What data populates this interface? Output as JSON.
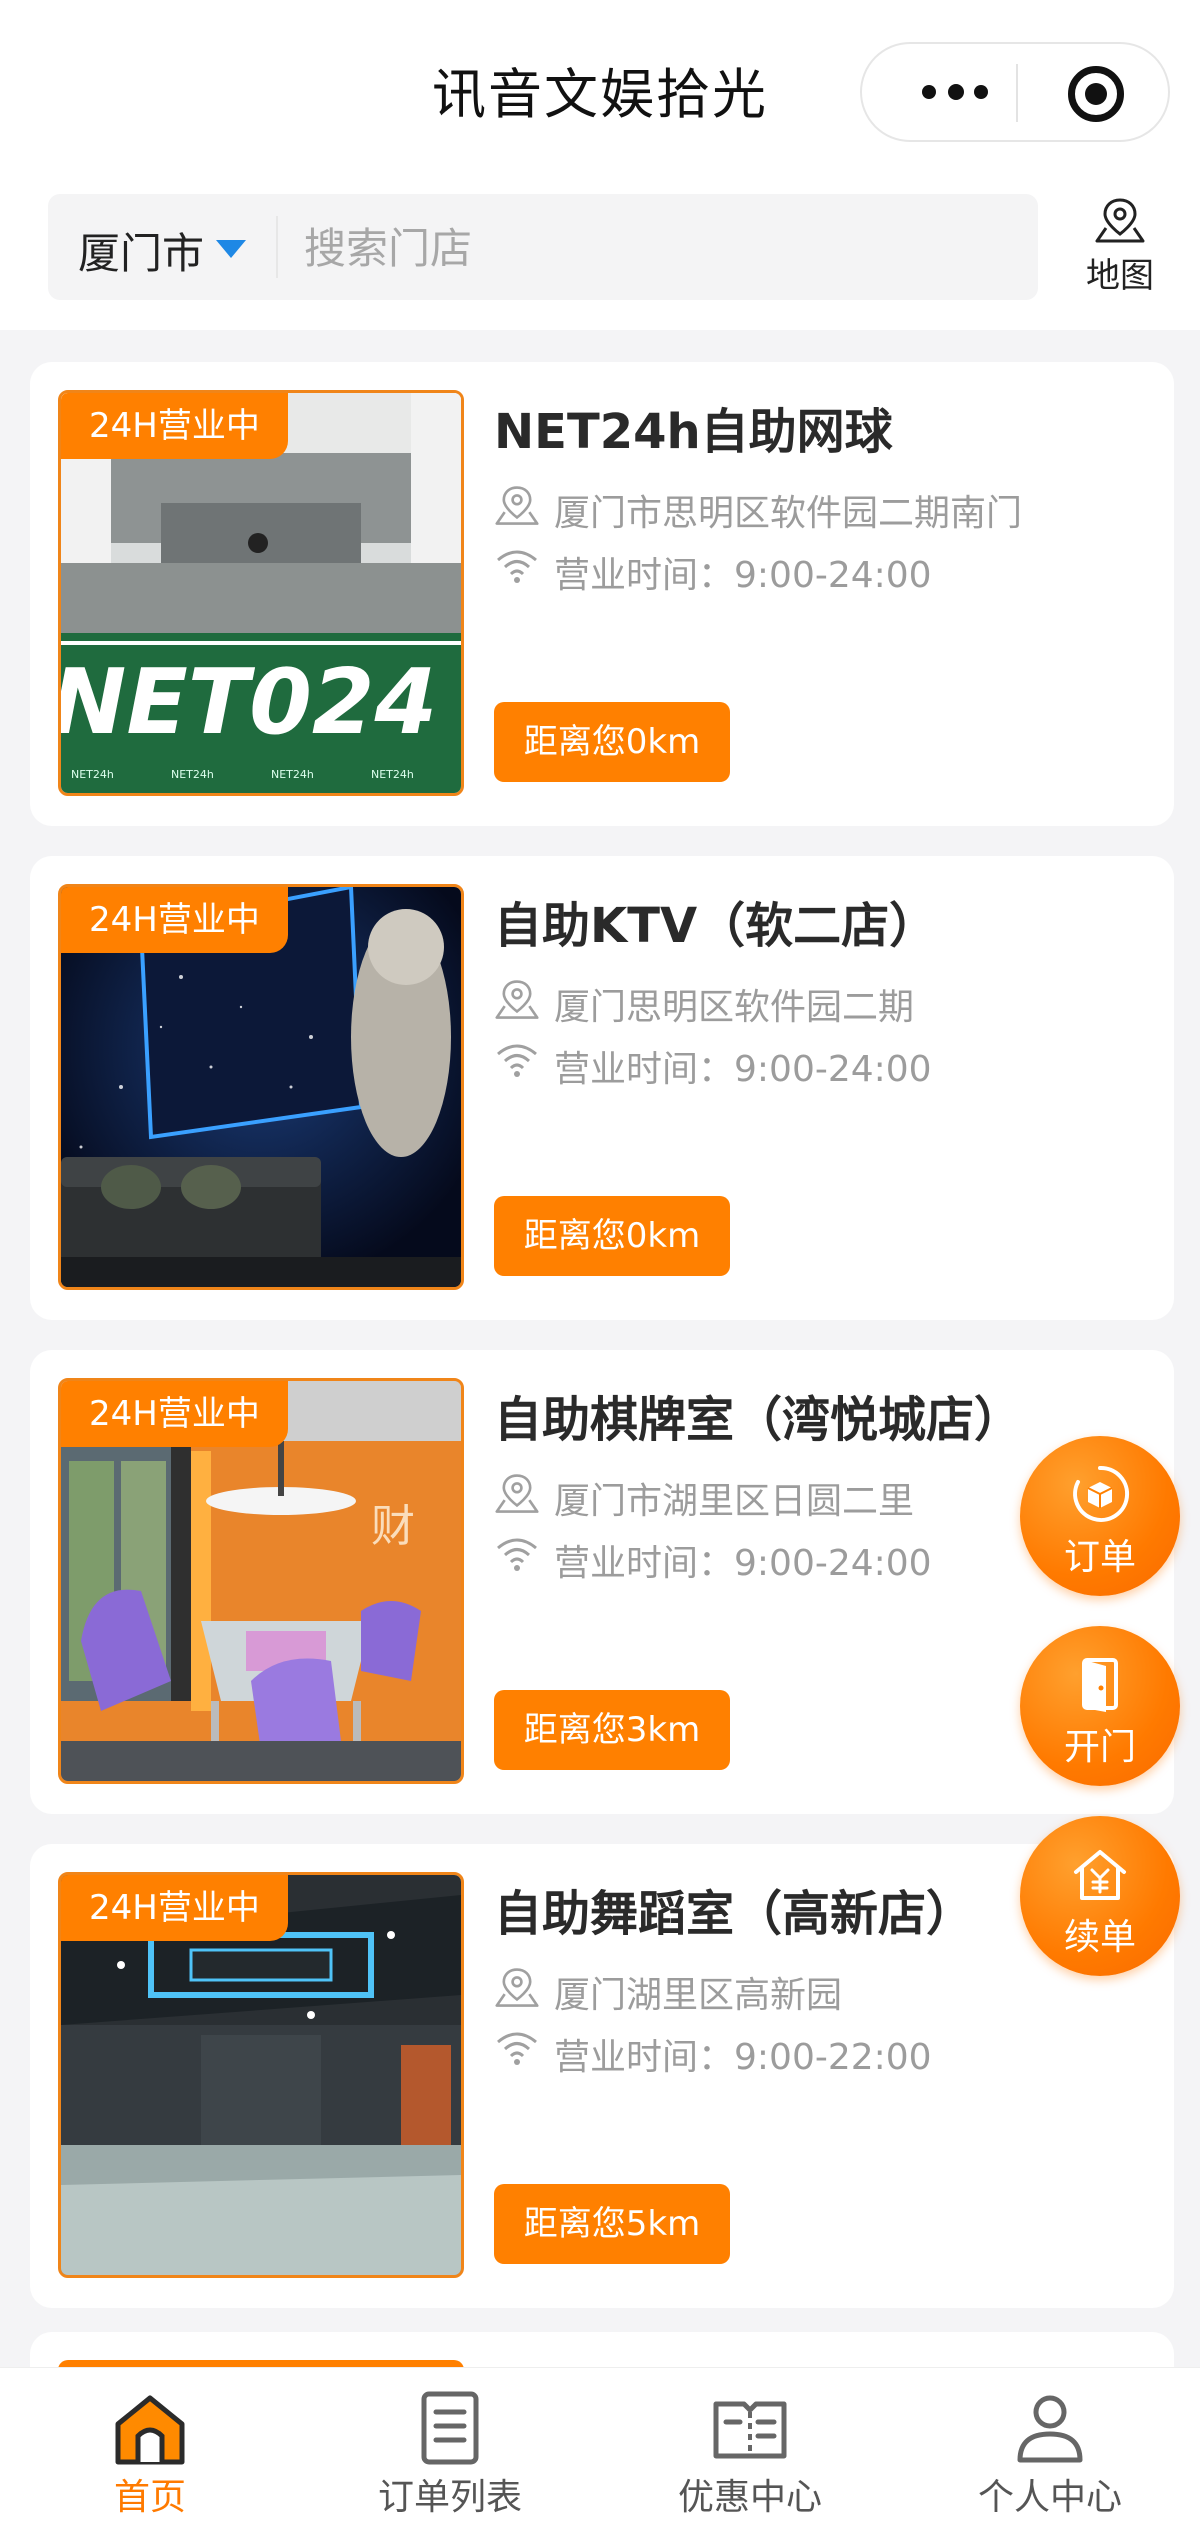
{
  "header": {
    "title": "讯音文娱拾光",
    "more_icon": "more-dots-icon",
    "close_icon": "target-icon"
  },
  "search": {
    "city": "厦门市",
    "placeholder": "搜索门店",
    "map_label": "地图"
  },
  "colors": {
    "accent": "#ff8000",
    "caret": "#1e88e5",
    "text_dark": "#2a2a2a",
    "text_muted": "#9c9c9c"
  },
  "stores": [
    {
      "badge": "24H营业中",
      "name": "NET24h自助网球",
      "address": "厦门市思明区软件园二期南门",
      "hours": "营业时间：9:00-24:00",
      "distance": "距离您0km"
    },
    {
      "badge": "24H营业中",
      "name": "自助KTV（软二店）",
      "address": "厦门思明区软件园二期",
      "hours": "营业时间：9:00-24:00",
      "distance": "距离您0km"
    },
    {
      "badge": "24H营业中",
      "name": "自助棋牌室（湾悦城店）",
      "address": "厦门市湖里区日圆二里",
      "hours": "营业时间：9:00-24:00",
      "distance": "距离您3km"
    },
    {
      "badge": "24H营业中",
      "name": "自助舞蹈室（高新店）",
      "address": "厦门湖里区高新园",
      "hours": "营业时间：9:00-22:00",
      "distance": "距离您5km"
    }
  ],
  "thumb_text": {
    "tennis_logo": "NET024",
    "tennis_small": "NET24h",
    "mahjong_sign": "财"
  },
  "fabs": [
    {
      "label": "订单",
      "icon": "order-cube-icon"
    },
    {
      "label": "开门",
      "icon": "door-icon"
    },
    {
      "label": "续单",
      "icon": "renew-house-icon"
    }
  ],
  "tabbar": [
    {
      "label": "首页",
      "icon": "home-icon",
      "active": true
    },
    {
      "label": "订单列表",
      "icon": "order-list-icon",
      "active": false
    },
    {
      "label": "优惠中心",
      "icon": "coupon-book-icon",
      "active": false
    },
    {
      "label": "个人中心",
      "icon": "user-icon",
      "active": false
    }
  ]
}
